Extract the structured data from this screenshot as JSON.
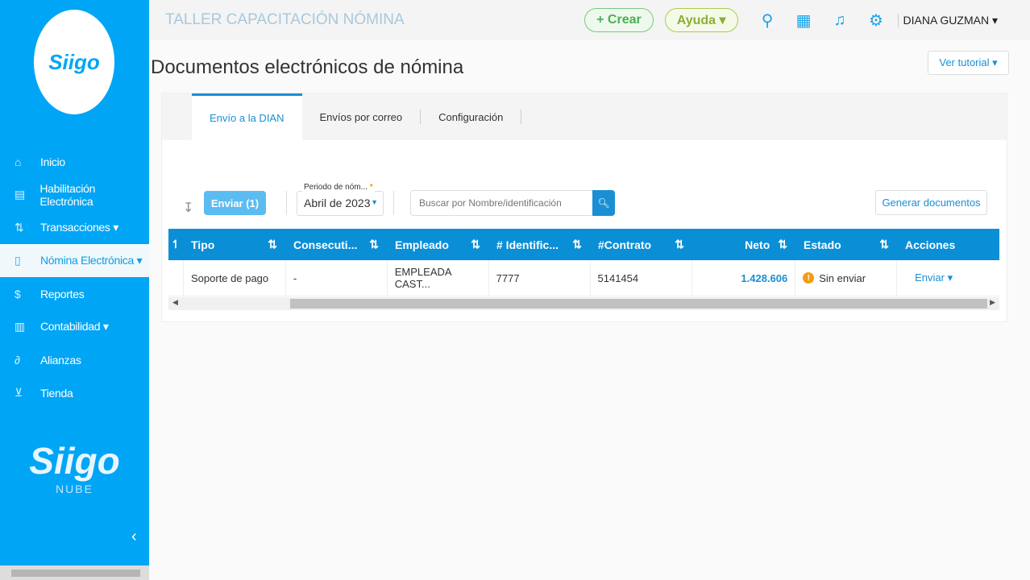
{
  "sidebar": {
    "logo": "Siigo",
    "items": [
      {
        "icon": "home-icon",
        "glyph": "⌂",
        "label": "Inicio"
      },
      {
        "icon": "document-icon",
        "glyph": "▤",
        "label": "Habilitación Electrónica"
      },
      {
        "icon": "transactions-icon",
        "glyph": "⇅",
        "label": "Transacciones ▾"
      },
      {
        "icon": "payroll-icon",
        "glyph": "▯",
        "label": "Nómina Electrónica ▾"
      },
      {
        "icon": "dollar-icon",
        "glyph": "$",
        "label": "Reportes"
      },
      {
        "icon": "accounting-icon",
        "glyph": "▥",
        "label": "Contabilidad ▾"
      },
      {
        "icon": "link-icon",
        "glyph": "∂",
        "label": "Alianzas"
      },
      {
        "icon": "cart-icon",
        "glyph": "⊻",
        "label": "Tienda"
      }
    ],
    "brand": "Siigo",
    "brand_sub": "NUBE",
    "collapse": "‹"
  },
  "topbar": {
    "company": "TALLER CAPACITACIÓN NÓMINA",
    "create": "+ Crear",
    "help": "Ayuda ▾",
    "user": "DIANA GUZMAN ▾"
  },
  "page": {
    "title": "Documentos electrónicos de nómina",
    "tutorial": "Ver tutorial ▾"
  },
  "tabs": [
    "Envío a la DIAN",
    "Envíos por correo",
    "Configuración"
  ],
  "toolbar": {
    "send": "Enviar (1)",
    "period_label": "Periodo de nóm...",
    "period_required": "*",
    "period_value": "Abril de 2023",
    "search_placeholder": "Buscar por Nombre/identificación",
    "generate": "Generar documentos"
  },
  "table": {
    "headers": [
      "Tipo",
      "Consecuti...",
      "Empleado",
      "# Identific...",
      "#Contrato",
      "Neto",
      "Estado",
      "Acciones"
    ],
    "rows": [
      {
        "tipo": "Soporte de pago",
        "consecutivo": "-",
        "empleado": "EMPLEADA CAST...",
        "identificacion": "7777",
        "contrato": "5141454",
        "neto": "1.428.606",
        "estado": "Sin enviar",
        "accion": "Enviar ▾"
      }
    ]
  },
  "colors": {
    "primary": "#00a5f5",
    "header": "#0a8fd7",
    "warning": "#f39c12"
  }
}
